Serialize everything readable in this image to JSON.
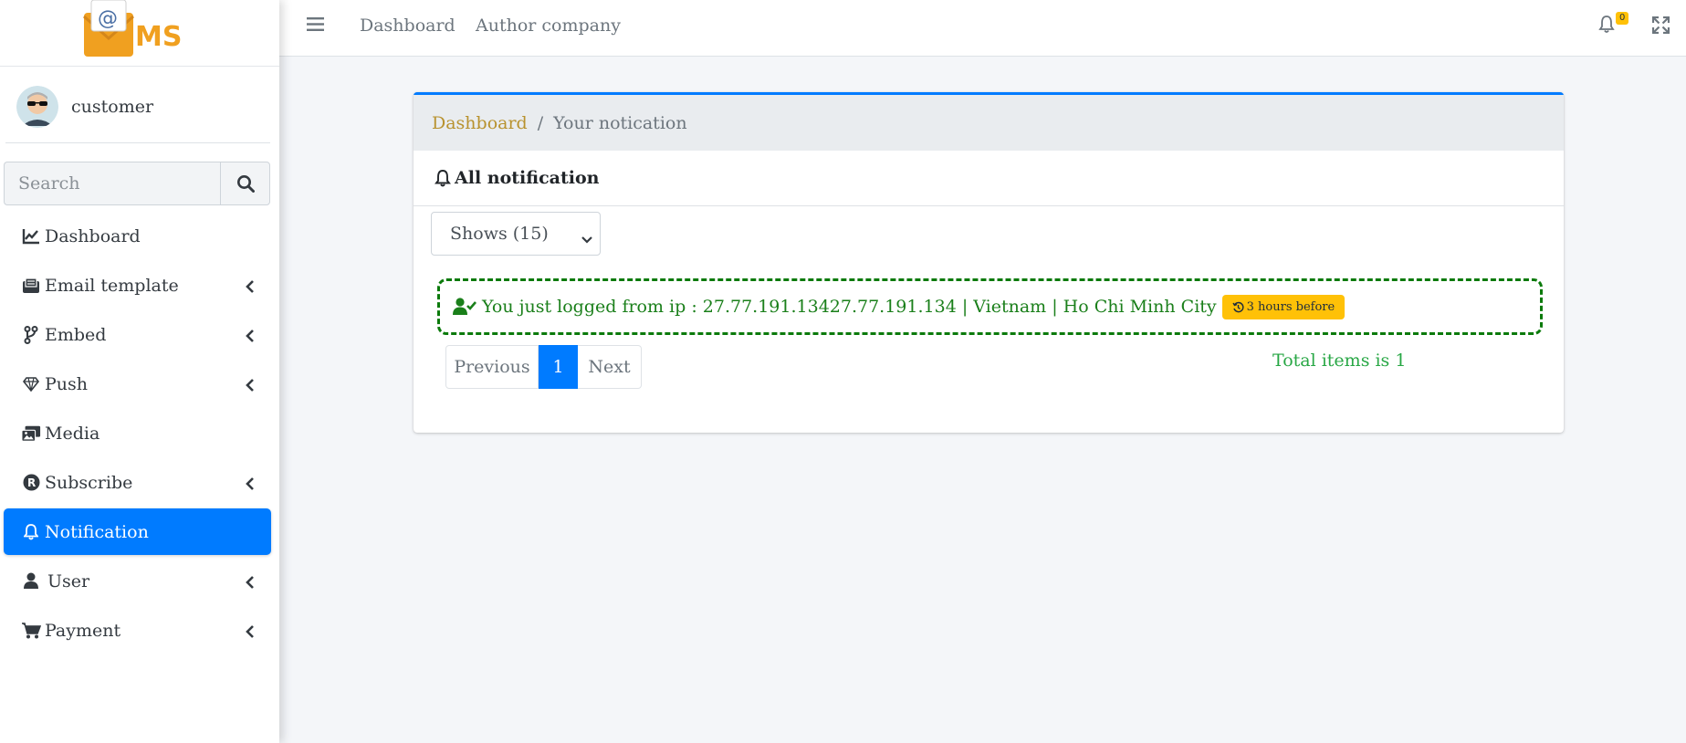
{
  "brand": {
    "logo_text": "MS",
    "logo_symbol": "@"
  },
  "user_panel": {
    "name": "customer"
  },
  "search": {
    "placeholder": "Search"
  },
  "sidebar": {
    "items": [
      {
        "label": "Dashboard",
        "icon": "chart-line-icon",
        "has_chevron": false,
        "active": false
      },
      {
        "label": "Email template",
        "icon": "envelope-open-icon",
        "has_chevron": true,
        "active": false
      },
      {
        "label": "Embed",
        "icon": "code-branch-icon",
        "has_chevron": true,
        "active": false
      },
      {
        "label": "Push",
        "icon": "gem-icon",
        "has_chevron": true,
        "active": false
      },
      {
        "label": "Media",
        "icon": "photo-video-icon",
        "has_chevron": false,
        "active": false
      },
      {
        "label": "Subscribe",
        "icon": "registered-icon",
        "has_chevron": true,
        "active": false
      },
      {
        "label": "Notification",
        "icon": "bell-icon",
        "has_chevron": false,
        "active": true
      },
      {
        "label": "User",
        "icon": "user-icon",
        "has_chevron": true,
        "active": false
      },
      {
        "label": "Payment",
        "icon": "shopping-cart-icon",
        "has_chevron": true,
        "active": false
      }
    ]
  },
  "topbar": {
    "links": [
      "Dashboard",
      "Author company"
    ],
    "notification_count": "0"
  },
  "breadcrumb": {
    "home": "Dashboard",
    "separator": "/",
    "current": "Your notication"
  },
  "card": {
    "title": "All notification",
    "select_value": "Shows (15)",
    "notifications": [
      {
        "text": "You just logged from ip : 27.77.191.13427.77.191.134 | Vietnam | Ho Chi Minh City",
        "time": "3 hours before"
      }
    ],
    "pagination": {
      "previous": "Previous",
      "current": "1",
      "next": "Next"
    },
    "total": "Total items is 1"
  },
  "colors": {
    "primary": "#007bff",
    "warning": "#ffc107",
    "success": "#28a745",
    "notif_green": "#1a7f1a"
  }
}
